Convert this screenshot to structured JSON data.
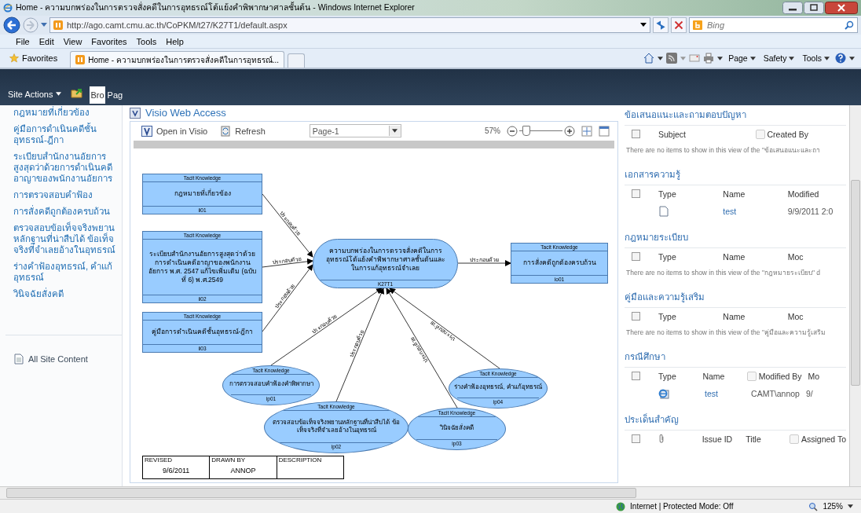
{
  "window": {
    "title": "Home - ความบกพร่องในการตรวจสั่งคดีในการอุทธรณ์โต้แย้งคำพิพากษาศาลชั้นต้น - Windows Internet Explorer"
  },
  "address_bar": {
    "url": "http://ago.camt.cmu.ac.th/CoPKM/t27/K27T1/default.aspx"
  },
  "search": {
    "placeholder": "Bing"
  },
  "menu": [
    "File",
    "Edit",
    "View",
    "Favorites",
    "Tools",
    "Help"
  ],
  "favorites": {
    "label": "Favorites"
  },
  "tabs": [
    {
      "label": "Home - ความบกพร่องในการตรวจสั่งคดีในการอุทธรณ์...",
      "selected": true
    }
  ],
  "command_bar": [
    "Page",
    "Safety",
    "Tools"
  ],
  "ribbon": {
    "site_actions": "Site Actions",
    "tabs": [
      {
        "label": "Bro",
        "selected": true
      },
      {
        "label": "Pag",
        "selected": false
      }
    ]
  },
  "nav": {
    "items": [
      "กฎหมายที่เกี่ยวข้อง",
      "คู่มือการดำเนินคดีชั้นอุทธรณ์-ฎีกา",
      "ระเบียบสำนักงานอัยการสูงสุดว่าด้วยการดำเนินคดีอาญาของพนักงานอัยการ",
      "การตรวจสอบคำฟ้อง",
      "การสั่งคดีถูกต้องครบถ้วน",
      "ตรวจสอบข้อเท็จจริงพยานหลักฐานที่น่าสืบได้ ข้อเท็จจริงที่จำเลยอ้างในอุทธรณ์",
      "ร่างคำฟ้องอุทธรณ์, คำแก้อุทธรณ์",
      "วินิจฉัยสั่งคดี"
    ],
    "all_site_content": "All Site Content"
  },
  "visio": {
    "title": "Visio Web Access",
    "open": "Open in Visio",
    "refresh": "Refresh",
    "page": "Page-1",
    "zoom": "57%",
    "zoom_slider": {
      "level": 0.15
    },
    "nodes": [
      {
        "kind": "box",
        "header": "Tacit Knowledge",
        "title": "กฎหมายที่เกี่ยวข้อง",
        "code": "ii01"
      },
      {
        "kind": "box",
        "header": "Tacit Knowledge",
        "title": "ระเบียบสำนักงานอัยการสูงสุดว่าด้วยการดำเนินคดีอาญาของพนักงานอัยการ พ.ศ. 2547 แก้ไขเพิ่มเติม (ฉบับที่ 6) พ.ศ.2549",
        "code": "ii02"
      },
      {
        "kind": "box",
        "header": "Tacit Knowledge",
        "title": "คู่มือการดำเนินคดีชั้นอุทธรณ์-ฎีกา",
        "code": "ii03"
      },
      {
        "kind": "pill",
        "title": "ความบกพร่องในการตรวจสั่งคดีในการอุทธรณ์โต้แย้งคำพิพากษาศาลชั้นต้นและในการแก้อุทธรณ์จำเลย",
        "code": "K27T1"
      },
      {
        "kind": "box",
        "header": "Tacit Knowledge",
        "title": "การสั่งคดีถูกต้องครบถ้วน",
        "code": "io01"
      },
      {
        "kind": "ellipse",
        "header": "Tacit Knowledge",
        "title": "การตรวจสอบคำฟ้องคำพิพากษา",
        "code": "ip01"
      },
      {
        "kind": "ellipse",
        "header": "Tacit Knowledge",
        "title": "ตรวจสอบข้อเท็จจริงพยานหลักฐานที่น่าสืบได้ ข้อเท็จจริงที่จำเลยอ้างในอุทธรณ์",
        "code": "ip02"
      },
      {
        "kind": "ellipse",
        "header": "Tacit Knowledge",
        "title": "วินิจฉัยสั่งคดี",
        "code": "ip03"
      },
      {
        "kind": "ellipse",
        "header": "Tacit Knowledge",
        "title": "ร่างคำฟ้องอุทธรณ์, คำแก้อุทธรณ์",
        "code": "ip04"
      }
    ],
    "connectors": [
      {
        "label": "ประกอบด้วย"
      },
      {
        "label": "ประกอบด้วย"
      },
      {
        "label": "ประกอบด้วย"
      },
      {
        "label": "ประกอบด้วย"
      },
      {
        "label": "ประกอบด้วย"
      },
      {
        "label": "ประกอบด้วย"
      },
      {
        "label": "ประกอบด้วย"
      },
      {
        "label": "ประกอบด้วย"
      }
    ],
    "title_block": [
      {
        "label": "REVISED",
        "value": "9/6/2011"
      },
      {
        "label": "DRAWN BY",
        "value": "ANNOP"
      },
      {
        "label": "DESCRIPTION"
      }
    ]
  },
  "lists": [
    {
      "title": "ข้อเสนอแนะและถามตอบปัญหา",
      "columns": [
        {
          "kind": "select",
          "checked": false
        },
        {
          "kind": "text",
          "label": "Subject"
        },
        {
          "kind": "filter",
          "label": "Created By",
          "checked": false
        }
      ],
      "message": "There are no items to show in this view of the \"ข้อเสนอแนะและถา"
    },
    {
      "title": "เอกสารความรู้",
      "columns": [
        {
          "kind": "select",
          "checked": false
        },
        {
          "kind": "text",
          "label": "Type"
        },
        {
          "kind": "text",
          "label": "Name"
        },
        {
          "kind": "text",
          "label": "Modified"
        }
      ],
      "rows": [
        {
          "cells": [
            {
              "kind": "blank"
            },
            {
              "kind": "doc"
            },
            {
              "kind": "link",
              "text": "test"
            },
            {
              "kind": "text",
              "text": "9/9/2011 2:0"
            }
          ]
        }
      ]
    },
    {
      "title": "กฎหมายระเบียบ",
      "columns": [
        {
          "kind": "select",
          "checked": false
        },
        {
          "kind": "text",
          "label": "Type"
        },
        {
          "kind": "text",
          "label": "Name"
        },
        {
          "kind": "text",
          "label": "Moc"
        }
      ],
      "message": "There are no items to show in this view of the \"กฎหมายระเบียบ\" d"
    },
    {
      "title": "คู่มือและความรู้เสริม",
      "columns": [
        {
          "kind": "select",
          "checked": false
        },
        {
          "kind": "text",
          "label": "Type"
        },
        {
          "kind": "text",
          "label": "Name"
        },
        {
          "kind": "text",
          "label": "Moc"
        }
      ],
      "message": "There are no items to show in this view of the \"คู่มือและความรู้เสริม"
    },
    {
      "title": "กรณีศึกษา",
      "columns": [
        {
          "kind": "select",
          "checked": false
        },
        {
          "kind": "text",
          "label": "Type"
        },
        {
          "kind": "text",
          "label": "Name"
        },
        {
          "kind": "filter",
          "label": "Modified By",
          "checked": false
        },
        {
          "kind": "text",
          "label": "Mo"
        }
      ],
      "rows": [
        {
          "cells": [
            {
              "kind": "blank"
            },
            {
              "kind": "web"
            },
            {
              "kind": "link",
              "text": "test"
            },
            {
              "kind": "text",
              "text": "CAMT\\annop"
            },
            {
              "kind": "text",
              "text": "9/"
            }
          ]
        }
      ]
    },
    {
      "title": "ประเด็นสำคัญ",
      "columns": [
        {
          "kind": "select",
          "checked": false
        },
        {
          "kind": "attach"
        },
        {
          "kind": "text",
          "label": "Issue ID"
        },
        {
          "kind": "text",
          "label": "Title"
        },
        {
          "kind": "filter",
          "label": "Assigned To",
          "checked": false
        }
      ]
    }
  ],
  "status_bar": {
    "zone": "Internet | Protected Mode: Off",
    "zoom": "125%"
  }
}
